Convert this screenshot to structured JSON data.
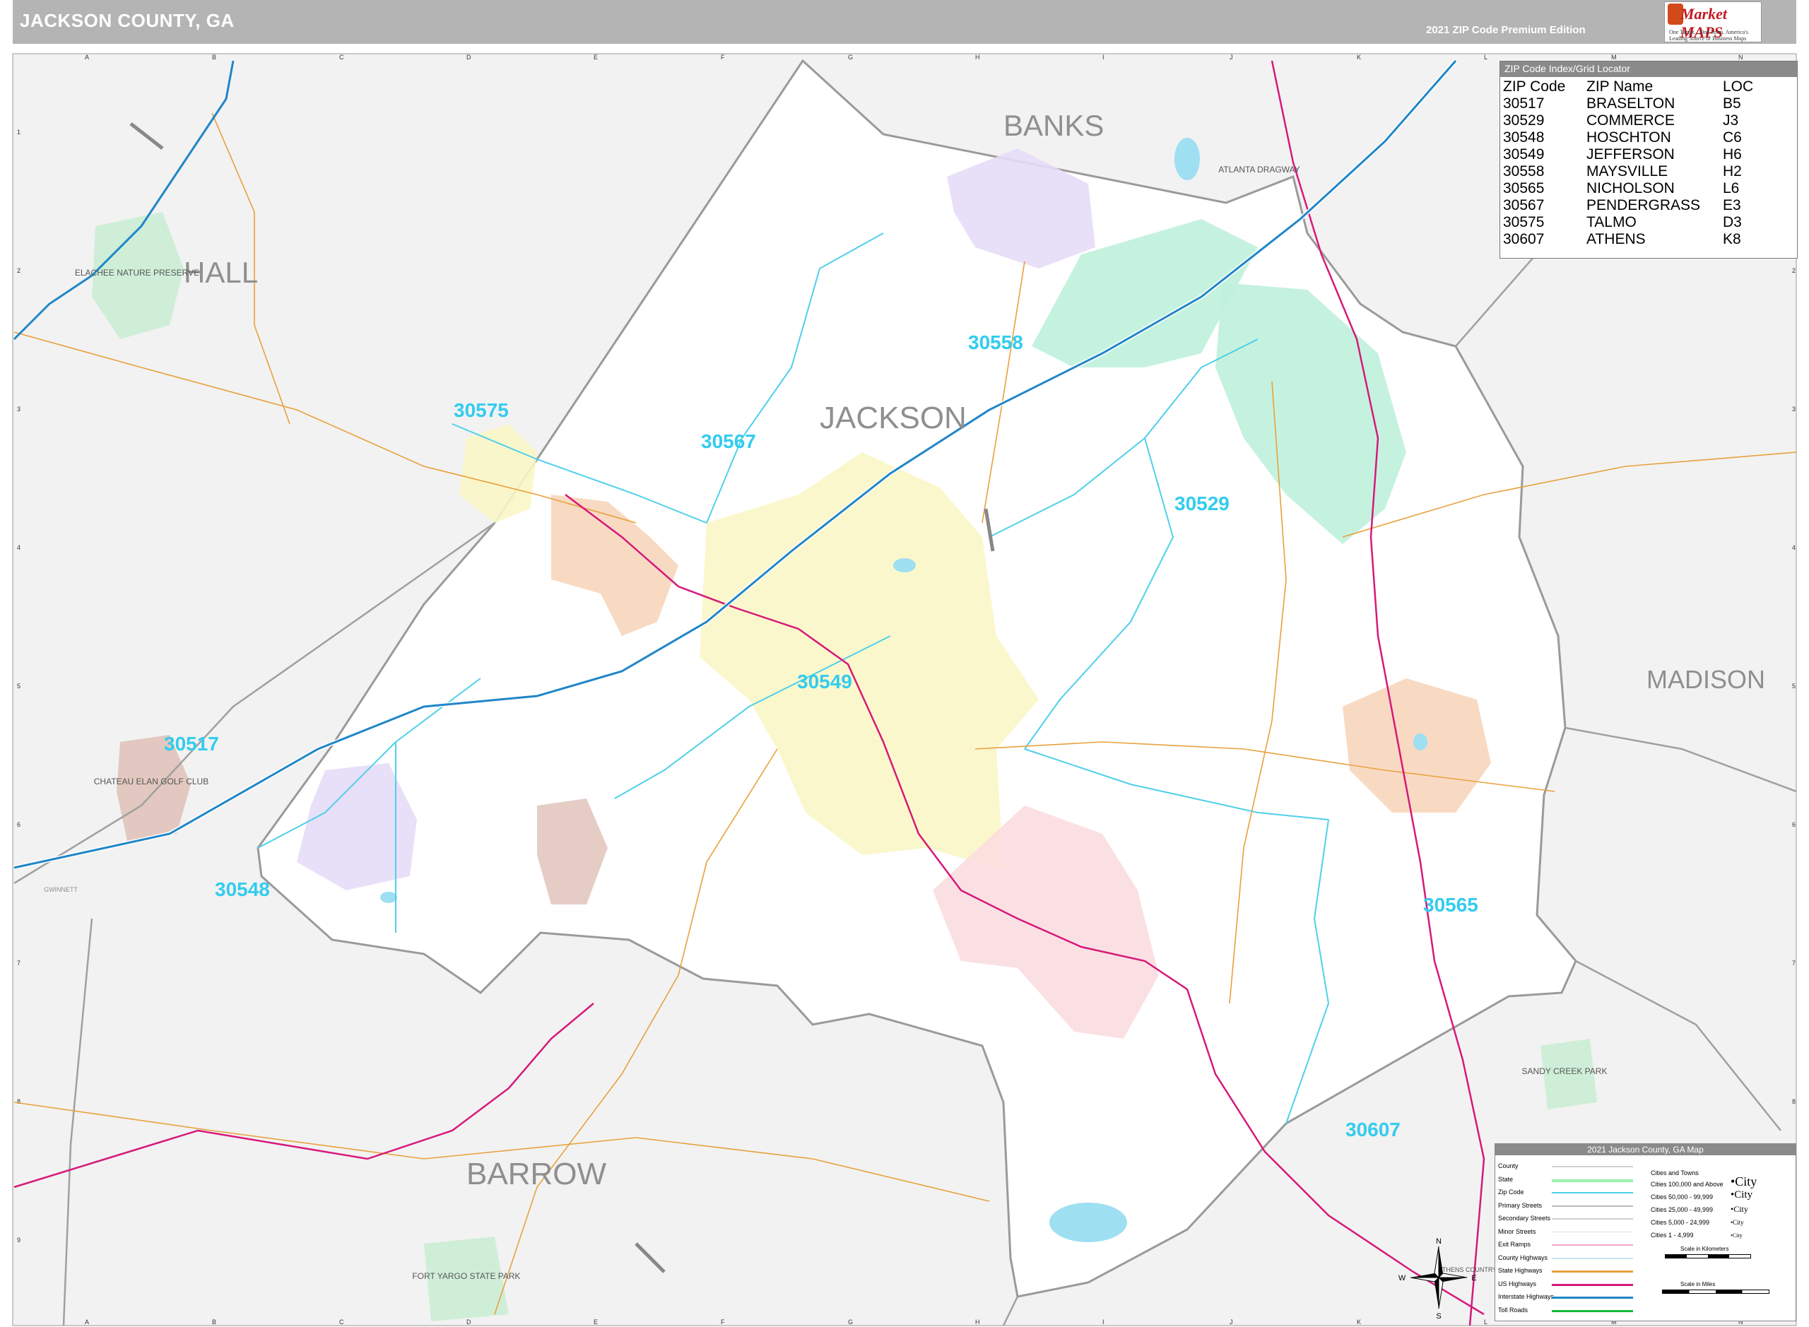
{
  "header": {
    "title": "JACKSON COUNTY, GA",
    "edition": "2021 ZIP Code Premium Edition",
    "brand": "Market MAPS",
    "brand_tagline": "One Target... One Team. America's Leading Source of Business Maps"
  },
  "grid": {
    "columns": [
      "A",
      "B",
      "C",
      "D",
      "E",
      "F",
      "G",
      "H",
      "I",
      "J",
      "K",
      "L",
      "M",
      "N"
    ],
    "rows": [
      "1",
      "2",
      "3",
      "4",
      "5",
      "6",
      "7",
      "8",
      "9"
    ]
  },
  "counties": {
    "banks": "BANKS",
    "hall": "HALL",
    "jackson": "JACKSON",
    "madison": "MADISON",
    "barrow": "BARROW",
    "gwinnett": "GWINNETT"
  },
  "zip_labels": {
    "z30558": "30558",
    "z30575": "30575",
    "z30567": "30567",
    "z30529": "30529",
    "z30549": "30549",
    "z30517": "30517",
    "z30548": "30548",
    "z30565": "30565",
    "z30607": "30607"
  },
  "places": {
    "elachee": "ELACHEE NATURE PRESERVE",
    "chateau": "CHATEAU ELAN GOLF CLUB",
    "atlanta_dragway": "ATLANTA DRAGWAY",
    "sandy_creek": "SANDY CREEK PARK",
    "fort_yargo": "FORT YARGO STATE PARK",
    "athens_cc": "ATHENS COUNTRY CLUB"
  },
  "zip_index": {
    "title": "ZIP Code Index/Grid Locator",
    "headers": [
      "ZIP Code",
      "ZIP Name",
      "LOC"
    ],
    "rows": [
      [
        "30517",
        "BRASELTON",
        "B5"
      ],
      [
        "30529",
        "COMMERCE",
        "J3"
      ],
      [
        "30548",
        "HOSCHTON",
        "C6"
      ],
      [
        "30549",
        "JEFFERSON",
        "H6"
      ],
      [
        "30558",
        "MAYSVILLE",
        "H2"
      ],
      [
        "30565",
        "NICHOLSON",
        "L6"
      ],
      [
        "30567",
        "PENDERGRASS",
        "E3"
      ],
      [
        "30575",
        "TALMO",
        "D3"
      ],
      [
        "30607",
        "ATHENS",
        "K8"
      ]
    ]
  },
  "legend": {
    "title": "2021 Jackson County, GA Map",
    "items": [
      "County",
      "State",
      "Zip Code",
      "Primary Streets",
      "Secondary Streets",
      "Minor Streets",
      "Exit Ramps",
      "County Highways",
      "State Highways",
      "US Highways",
      "Interstate Highways",
      "Toll Roads"
    ],
    "cities_header": "Cities and Towns",
    "populations": [
      "Cities 100,000 and Above",
      "Cities 50,000 - 99,999",
      "Cities 25,000 - 49,999",
      "Cities 5,000 - 24,999",
      "Cities 1 - 4,999"
    ],
    "city_samples": [
      "•City",
      "•City",
      "•City",
      "•City",
      "•City"
    ],
    "scale_miles_label": "Scale in Kilometers",
    "scale_km_label": "Scale in Miles"
  },
  "compass": {
    "n": "N",
    "s": "S",
    "e": "E",
    "w": "W"
  },
  "colors": {
    "header": "#b4b4b4",
    "outside": "#f2f2f2",
    "county_fill": "#ffffff",
    "zip_label": "#33ccee",
    "interstate": "#1f86c8",
    "us_highway": "#d6197a",
    "state_highway": "#e8a13c",
    "zip_boundary": "#4fd0ea"
  }
}
